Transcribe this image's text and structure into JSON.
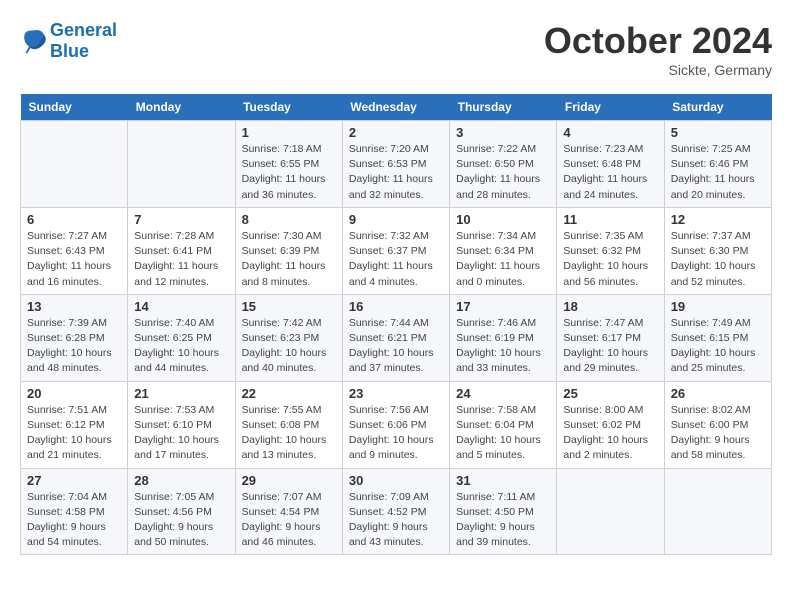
{
  "header": {
    "logo_line1": "General",
    "logo_line2": "Blue",
    "month_title": "October 2024",
    "subtitle": "Sickte, Germany"
  },
  "days_of_week": [
    "Sunday",
    "Monday",
    "Tuesday",
    "Wednesday",
    "Thursday",
    "Friday",
    "Saturday"
  ],
  "weeks": [
    [
      {
        "day": "",
        "info": ""
      },
      {
        "day": "",
        "info": ""
      },
      {
        "day": "1",
        "info": "Sunrise: 7:18 AM\nSunset: 6:55 PM\nDaylight: 11 hours\nand 36 minutes."
      },
      {
        "day": "2",
        "info": "Sunrise: 7:20 AM\nSunset: 6:53 PM\nDaylight: 11 hours\nand 32 minutes."
      },
      {
        "day": "3",
        "info": "Sunrise: 7:22 AM\nSunset: 6:50 PM\nDaylight: 11 hours\nand 28 minutes."
      },
      {
        "day": "4",
        "info": "Sunrise: 7:23 AM\nSunset: 6:48 PM\nDaylight: 11 hours\nand 24 minutes."
      },
      {
        "day": "5",
        "info": "Sunrise: 7:25 AM\nSunset: 6:46 PM\nDaylight: 11 hours\nand 20 minutes."
      }
    ],
    [
      {
        "day": "6",
        "info": "Sunrise: 7:27 AM\nSunset: 6:43 PM\nDaylight: 11 hours\nand 16 minutes."
      },
      {
        "day": "7",
        "info": "Sunrise: 7:28 AM\nSunset: 6:41 PM\nDaylight: 11 hours\nand 12 minutes."
      },
      {
        "day": "8",
        "info": "Sunrise: 7:30 AM\nSunset: 6:39 PM\nDaylight: 11 hours\nand 8 minutes."
      },
      {
        "day": "9",
        "info": "Sunrise: 7:32 AM\nSunset: 6:37 PM\nDaylight: 11 hours\nand 4 minutes."
      },
      {
        "day": "10",
        "info": "Sunrise: 7:34 AM\nSunset: 6:34 PM\nDaylight: 11 hours\nand 0 minutes."
      },
      {
        "day": "11",
        "info": "Sunrise: 7:35 AM\nSunset: 6:32 PM\nDaylight: 10 hours\nand 56 minutes."
      },
      {
        "day": "12",
        "info": "Sunrise: 7:37 AM\nSunset: 6:30 PM\nDaylight: 10 hours\nand 52 minutes."
      }
    ],
    [
      {
        "day": "13",
        "info": "Sunrise: 7:39 AM\nSunset: 6:28 PM\nDaylight: 10 hours\nand 48 minutes."
      },
      {
        "day": "14",
        "info": "Sunrise: 7:40 AM\nSunset: 6:25 PM\nDaylight: 10 hours\nand 44 minutes."
      },
      {
        "day": "15",
        "info": "Sunrise: 7:42 AM\nSunset: 6:23 PM\nDaylight: 10 hours\nand 40 minutes."
      },
      {
        "day": "16",
        "info": "Sunrise: 7:44 AM\nSunset: 6:21 PM\nDaylight: 10 hours\nand 37 minutes."
      },
      {
        "day": "17",
        "info": "Sunrise: 7:46 AM\nSunset: 6:19 PM\nDaylight: 10 hours\nand 33 minutes."
      },
      {
        "day": "18",
        "info": "Sunrise: 7:47 AM\nSunset: 6:17 PM\nDaylight: 10 hours\nand 29 minutes."
      },
      {
        "day": "19",
        "info": "Sunrise: 7:49 AM\nSunset: 6:15 PM\nDaylight: 10 hours\nand 25 minutes."
      }
    ],
    [
      {
        "day": "20",
        "info": "Sunrise: 7:51 AM\nSunset: 6:12 PM\nDaylight: 10 hours\nand 21 minutes."
      },
      {
        "day": "21",
        "info": "Sunrise: 7:53 AM\nSunset: 6:10 PM\nDaylight: 10 hours\nand 17 minutes."
      },
      {
        "day": "22",
        "info": "Sunrise: 7:55 AM\nSunset: 6:08 PM\nDaylight: 10 hours\nand 13 minutes."
      },
      {
        "day": "23",
        "info": "Sunrise: 7:56 AM\nSunset: 6:06 PM\nDaylight: 10 hours\nand 9 minutes."
      },
      {
        "day": "24",
        "info": "Sunrise: 7:58 AM\nSunset: 6:04 PM\nDaylight: 10 hours\nand 5 minutes."
      },
      {
        "day": "25",
        "info": "Sunrise: 8:00 AM\nSunset: 6:02 PM\nDaylight: 10 hours\nand 2 minutes."
      },
      {
        "day": "26",
        "info": "Sunrise: 8:02 AM\nSunset: 6:00 PM\nDaylight: 9 hours\nand 58 minutes."
      }
    ],
    [
      {
        "day": "27",
        "info": "Sunrise: 7:04 AM\nSunset: 4:58 PM\nDaylight: 9 hours\nand 54 minutes."
      },
      {
        "day": "28",
        "info": "Sunrise: 7:05 AM\nSunset: 4:56 PM\nDaylight: 9 hours\nand 50 minutes."
      },
      {
        "day": "29",
        "info": "Sunrise: 7:07 AM\nSunset: 4:54 PM\nDaylight: 9 hours\nand 46 minutes."
      },
      {
        "day": "30",
        "info": "Sunrise: 7:09 AM\nSunset: 4:52 PM\nDaylight: 9 hours\nand 43 minutes."
      },
      {
        "day": "31",
        "info": "Sunrise: 7:11 AM\nSunset: 4:50 PM\nDaylight: 9 hours\nand 39 minutes."
      },
      {
        "day": "",
        "info": ""
      },
      {
        "day": "",
        "info": ""
      }
    ]
  ]
}
